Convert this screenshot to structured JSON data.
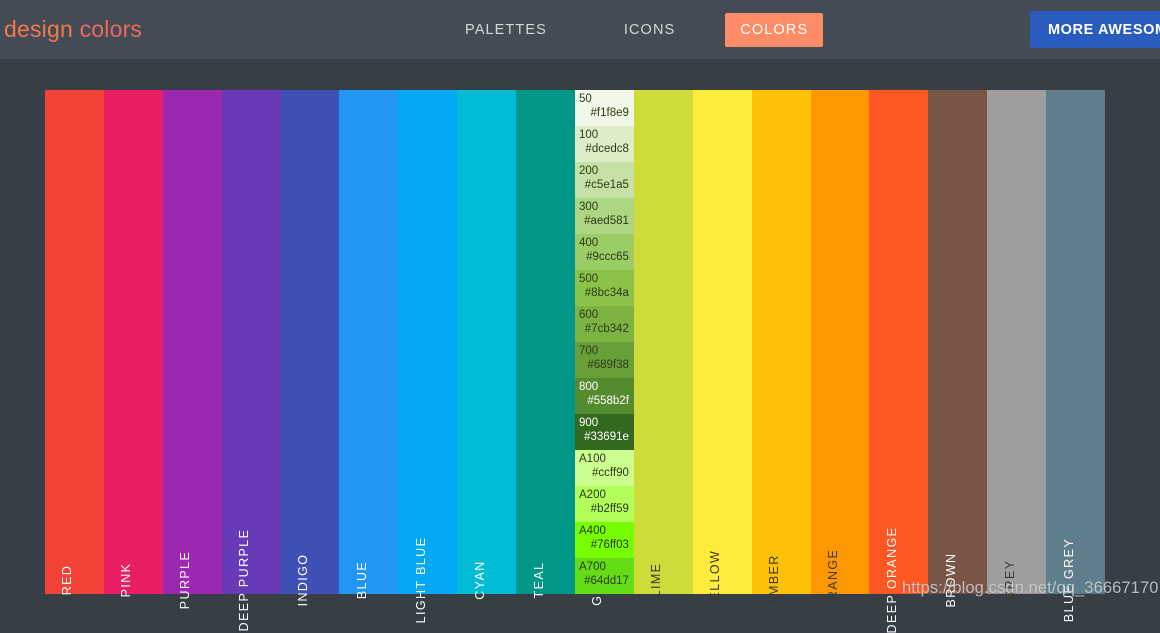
{
  "header": {
    "logo_word1": "design ",
    "logo_word2": "colors",
    "nav": [
      {
        "label": "PALETTES",
        "active": false
      },
      {
        "label": "ICONS",
        "active": false
      },
      {
        "label": "COLORS",
        "active": true
      }
    ],
    "cta_label": "MORE AWESOME",
    "colors": {
      "bar_bg": "#434b54",
      "logo_accent": "#f0695f",
      "nav_active_bg": "#fd8c67",
      "cta_bg": "#2a5cc0"
    }
  },
  "body": {
    "background": "#373e46"
  },
  "watermark": "https://blog.csdn.net/qq_36667170",
  "palette": {
    "columns": [
      {
        "name": "RED",
        "swatch": "#f44336",
        "label_dark": false
      },
      {
        "name": "PINK",
        "swatch": "#e91e63",
        "label_dark": false
      },
      {
        "name": "PURPLE",
        "swatch": "#9c27b0",
        "label_dark": false
      },
      {
        "name": "DEEP PURPLE",
        "swatch": "#673ab7",
        "label_dark": false
      },
      {
        "name": "INDIGO",
        "swatch": "#3f51b5",
        "label_dark": false
      },
      {
        "name": "BLUE",
        "swatch": "#2196f3",
        "label_dark": false
      },
      {
        "name": "LIGHT BLUE",
        "swatch": "#03a9f4",
        "label_dark": false
      },
      {
        "name": "CYAN",
        "swatch": "#00bcd4",
        "label_dark": false
      },
      {
        "name": "TEAL",
        "swatch": "#009688",
        "label_dark": false
      },
      {
        "name": "GREEN",
        "swatch": "#4caf50",
        "label_dark": false
      },
      {
        "name": "LIME",
        "swatch": "#cddc39",
        "label_dark": true
      },
      {
        "name": "YELLOW",
        "swatch": "#ffeb3b",
        "label_dark": true
      },
      {
        "name": "AMBER",
        "swatch": "#ffc107",
        "label_dark": true
      },
      {
        "name": "ORANGE",
        "swatch": "#ff9800",
        "label_dark": true
      },
      {
        "name": "DEEP ORANGE",
        "swatch": "#ff5722",
        "label_dark": false
      },
      {
        "name": "BROWN",
        "swatch": "#795548",
        "label_dark": false
      },
      {
        "name": "GREY",
        "swatch": "#9e9e9e",
        "label_dark": true
      },
      {
        "name": "BLUE GREY",
        "swatch": "#607d8b",
        "label_dark": false
      }
    ],
    "expanded_column_index": 9,
    "expanded_shades": [
      {
        "level": "50",
        "hex": "#f1f8e9",
        "on_dark": false
      },
      {
        "level": "100",
        "hex": "#dcedc8",
        "on_dark": false
      },
      {
        "level": "200",
        "hex": "#c5e1a5",
        "on_dark": false
      },
      {
        "level": "300",
        "hex": "#aed581",
        "on_dark": false
      },
      {
        "level": "400",
        "hex": "#9ccc65",
        "on_dark": false
      },
      {
        "level": "500",
        "hex": "#8bc34a",
        "on_dark": false
      },
      {
        "level": "600",
        "hex": "#7cb342",
        "on_dark": false
      },
      {
        "level": "700",
        "hex": "#689f38",
        "on_dark": false
      },
      {
        "level": "800",
        "hex": "#558b2f",
        "on_dark": true
      },
      {
        "level": "900",
        "hex": "#33691e",
        "on_dark": true
      },
      {
        "level": "A100",
        "hex": "#ccff90",
        "on_dark": false
      },
      {
        "level": "A200",
        "hex": "#b2ff59",
        "on_dark": false
      },
      {
        "level": "A400",
        "hex": "#76ff03",
        "on_dark": false
      },
      {
        "level": "A700",
        "hex": "#64dd17",
        "on_dark": false
      }
    ]
  }
}
